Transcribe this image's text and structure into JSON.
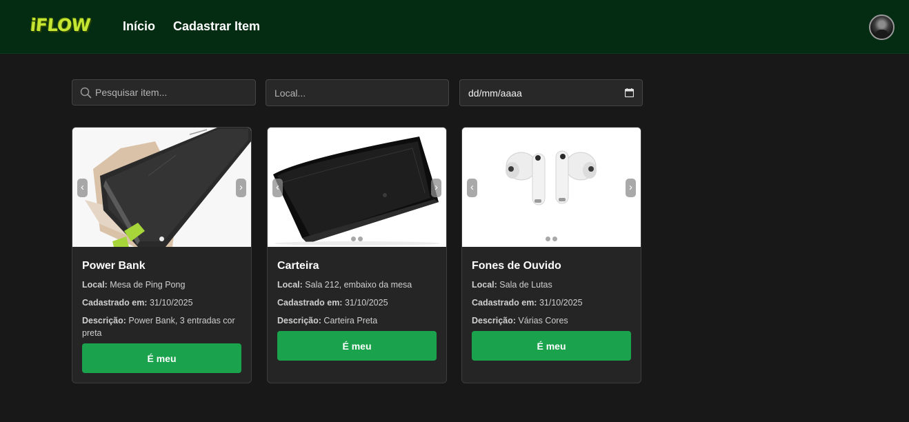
{
  "navbar": {
    "logo": "iFLOW",
    "links": [
      "Início",
      "Cadastrar Item"
    ]
  },
  "filters": {
    "search_placeholder": "Pesquisar item...",
    "local_placeholder": "Local...",
    "date_placeholder": "dd/mm/aaaa"
  },
  "labels": {
    "local": "Local:",
    "registered": "Cadastrado em:",
    "description": "Descrição:"
  },
  "items": [
    {
      "title": "Power Bank",
      "local": "Mesa de Ping Pong",
      "registered": "31/10/2025",
      "description": "Power Bank, 3 entradas cor preta",
      "button": "É meu"
    },
    {
      "title": "Carteira",
      "local": "Sala 212, embaixo da mesa",
      "registered": "31/10/2025",
      "description": "Carteira Preta",
      "button": "É meu"
    },
    {
      "title": "Fones de Ouvido",
      "local": "Sala de Lutas",
      "registered": "31/10/2025",
      "description": "Várias Cores",
      "button": "É meu"
    }
  ],
  "colors": {
    "navbar": "#032c12",
    "background": "#181818",
    "card": "#252525",
    "accent": "#1aa24c",
    "logo": "#c5e632"
  },
  "icons": [
    "search-icon",
    "calendar-icon",
    "chevron-left-icon",
    "chevron-right-icon",
    "avatar"
  ]
}
